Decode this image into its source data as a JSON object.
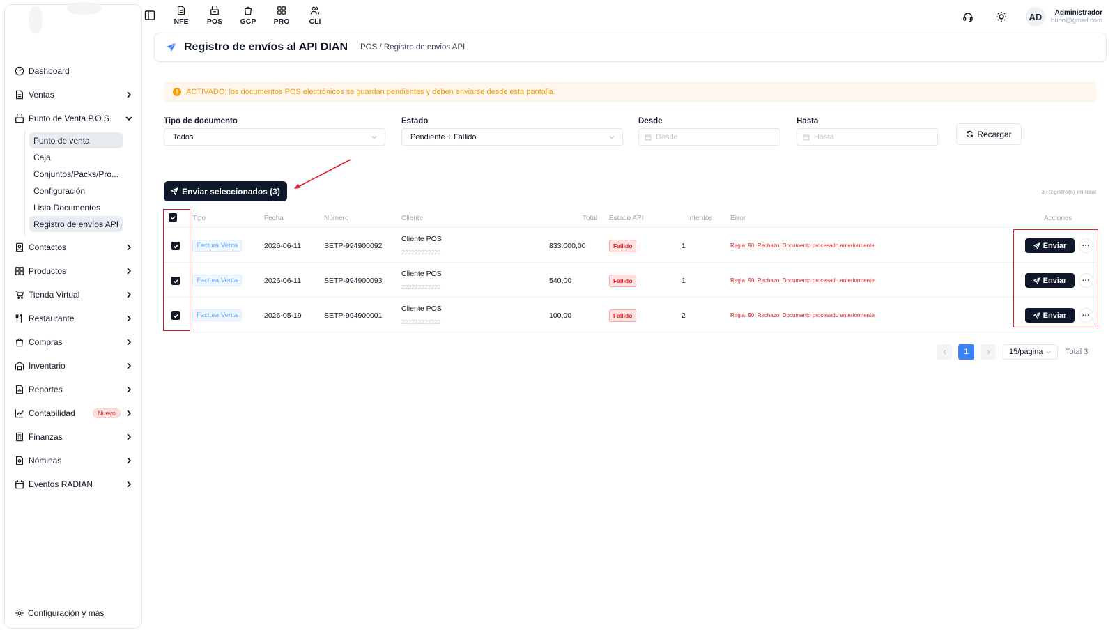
{
  "sidebar": {
    "items": [
      {
        "label": "Dashboard",
        "icon": "dashboard-icon",
        "has_chevron": false
      },
      {
        "label": "Ventas",
        "icon": "document-icon",
        "has_chevron": true
      },
      {
        "label": "Punto de Venta P.O.S.",
        "icon": "store-icon",
        "has_chevron": true,
        "expanded": true
      }
    ],
    "pos_sub": [
      {
        "label": "Punto de venta",
        "active": true
      },
      {
        "label": "Caja",
        "active": false
      },
      {
        "label": "Conjuntos/Packs/Pro...",
        "active": false
      },
      {
        "label": "Configuración",
        "active": false
      },
      {
        "label": "Lista Documentos",
        "active": false
      },
      {
        "label": "Registro de envíos API",
        "active": true
      }
    ],
    "items_after": [
      {
        "label": "Contactos",
        "icon": "contacts-icon"
      },
      {
        "label": "Productos",
        "icon": "grid-icon"
      },
      {
        "label": "Tienda Virtual",
        "icon": "cart-icon"
      },
      {
        "label": "Restaurante",
        "icon": "utensils-icon"
      },
      {
        "label": "Compras",
        "icon": "bag-icon"
      },
      {
        "label": "Inventario",
        "icon": "warehouse-icon"
      },
      {
        "label": "Reportes",
        "icon": "report-icon"
      },
      {
        "label": "Contabilidad",
        "icon": "chart-icon",
        "badge": "Nuevo"
      },
      {
        "label": "Finanzas",
        "icon": "calculator-icon"
      },
      {
        "label": "Nóminas",
        "icon": "payroll-icon"
      },
      {
        "label": "Eventos RADIAN",
        "icon": "calendar-icon"
      }
    ],
    "settings_label": "Configuración y más"
  },
  "topnav": [
    {
      "label": "NFE",
      "icon": "file-icon"
    },
    {
      "label": "POS",
      "icon": "pos-icon"
    },
    {
      "label": "GCP",
      "icon": "bag-icon"
    },
    {
      "label": "PRO",
      "icon": "grid-icon"
    },
    {
      "label": "CLI",
      "icon": "users-icon"
    }
  ],
  "user": {
    "initials": "AD",
    "name": "Administrador",
    "email": "buho@gmail.com"
  },
  "header": {
    "title": "Registro de envíos al API DIAN",
    "breadcrumb": "POS / Registro de envios API"
  },
  "alert": {
    "text": "ACTIVADO: los documentos POS electrónicos se guardan pendientes y deben enviarse desde esta pantalla."
  },
  "filters": {
    "tipo_label": "Tipo de documento",
    "tipo_value": "Todos",
    "estado_label": "Estado",
    "estado_value": "Pendiente + Fallido",
    "desde_label": "Desde",
    "desde_placeholder": "Desde",
    "hasta_label": "Hasta",
    "hasta_placeholder": "Hasta",
    "reload_label": "Recargar"
  },
  "send_selected_label": "Enviar seleccionados (3)",
  "records_total": "3 Registro(s) en total",
  "table": {
    "headers": {
      "tipo": "Tipo",
      "fecha": "Fecha",
      "numero": "Número",
      "cliente": "Cliente",
      "total": "Total",
      "estado": "Estado API",
      "intentos": "Intentos",
      "error": "Error",
      "acciones": "Acciones"
    },
    "rows": [
      {
        "tipo": "Factura Venta",
        "fecha": "2026-06-11",
        "numero": "SETP-994900092",
        "cliente": "Cliente POS",
        "cliente_id": "222222222222",
        "total": "833.000,00",
        "estado": "Fallido",
        "intentos": "1",
        "error": "Regla: 90, Rechazo: Documento procesado anteriormente.",
        "action": "Enviar"
      },
      {
        "tipo": "Factura Venta",
        "fecha": "2026-06-11",
        "numero": "SETP-994900093",
        "cliente": "Cliente POS",
        "cliente_id": "222222222222",
        "total": "540,00",
        "estado": "Fallido",
        "intentos": "1",
        "error": "Regla: 90, Rechazo: Documento procesado anteriormente.",
        "action": "Enviar"
      },
      {
        "tipo": "Factura Venta",
        "fecha": "2026-05-19",
        "numero": "SETP-994900001",
        "cliente": "Cliente POS",
        "cliente_id": "222222222222",
        "total": "100,00",
        "estado": "Fallido",
        "intentos": "2",
        "error": "Regla: 90, Rechazo: Documento procesado anteriormente.",
        "action": "Enviar"
      }
    ]
  },
  "pagination": {
    "current": "1",
    "page_size": "15/página",
    "total": "Total 3"
  },
  "colors": {
    "primary_dark": "#0f172a",
    "accent_blue": "#3b82f6",
    "warning": "#f59e0b",
    "danger": "#dc2626",
    "highlight": "#e11d2a"
  }
}
